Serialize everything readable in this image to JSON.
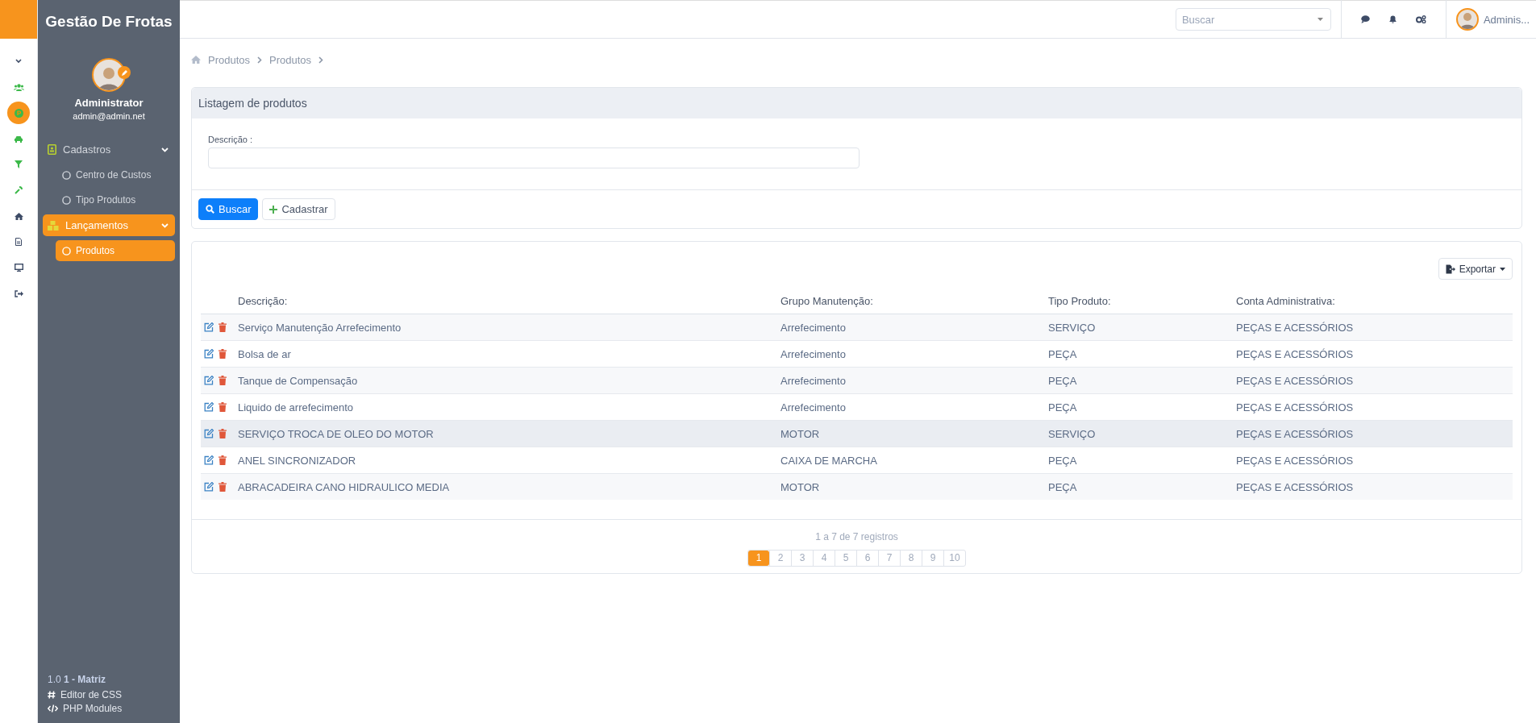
{
  "icon_bar": [
    {
      "kind": "chevron",
      "selected": false
    },
    {
      "kind": "users",
      "selected": false
    },
    {
      "kind": "parking",
      "selected": true
    },
    {
      "kind": "car",
      "selected": false
    },
    {
      "kind": "filter",
      "selected": false
    },
    {
      "kind": "wrench",
      "selected": false
    },
    {
      "kind": "home",
      "selected": false
    },
    {
      "kind": "file",
      "selected": false
    },
    {
      "kind": "monitor",
      "selected": false
    },
    {
      "kind": "signout",
      "selected": false
    }
  ],
  "sidebar": {
    "title": "Gestão De Frotas",
    "user": {
      "name": "Administrator",
      "email": "admin@admin.net"
    },
    "menu": [
      {
        "kind": "contact",
        "label": "Cadastros",
        "expanded": true,
        "selected": false,
        "children": [
          {
            "label": "Centro de Custos",
            "selected": false
          },
          {
            "label": "Tipo Produtos",
            "selected": false
          }
        ]
      },
      {
        "kind": "boxes",
        "label": "Lançamentos",
        "expanded": true,
        "selected": true,
        "children": [
          {
            "label": "Produtos",
            "selected": true
          }
        ]
      }
    ],
    "footer": {
      "version": "1.0 **1 - Matriz**",
      "links": [
        {
          "kind": "hash",
          "label": "Editor de CSS"
        },
        {
          "kind": "code",
          "label": "PHP Modules"
        }
      ]
    }
  },
  "topbar": {
    "search": {
      "placeholder": "Buscar"
    },
    "user": "Adminis..."
  },
  "breadcrumb": [
    "Produtos",
    "Produtos"
  ],
  "filter_panel": {
    "title": "Listagem de produtos",
    "field": {
      "label": "Descrição :"
    },
    "buttons": [
      {
        "kind": "primary",
        "label": "Buscar"
      },
      {
        "kind": "default",
        "label": "Cadastrar"
      }
    ]
  },
  "table": {
    "export": "Exportar",
    "columns": [
      "Descrição:",
      "Grupo Manutenção:",
      "Tipo Produto:",
      "Conta Administrativa:"
    ],
    "rows": [
      {
        "selected": false,
        "cells": [
          "Serviço Manutenção Arrefecimento",
          "Arrefecimento",
          "SERVIÇO",
          "PEÇAS E ACESSÓRIOS"
        ]
      },
      {
        "selected": false,
        "cells": [
          "Bolsa de ar",
          "Arrefecimento",
          "PEÇA",
          "PEÇAS E ACESSÓRIOS"
        ]
      },
      {
        "selected": false,
        "cells": [
          "Tanque de Compensação",
          "Arrefecimento",
          "PEÇA",
          "PEÇAS E ACESSÓRIOS"
        ]
      },
      {
        "selected": false,
        "cells": [
          "Liquido de arrefecimento",
          "Arrefecimento",
          "PEÇA",
          "PEÇAS E ACESSÓRIOS"
        ]
      },
      {
        "selected": true,
        "cells": [
          "SERVIÇO TROCA DE OLEO DO MOTOR",
          "MOTOR",
          "SERVIÇO",
          "PEÇAS E ACESSÓRIOS"
        ]
      },
      {
        "selected": false,
        "cells": [
          "ANEL SINCRONIZADOR",
          "CAIXA DE MARCHA",
          "PEÇA",
          "PEÇAS E ACESSÓRIOS"
        ]
      },
      {
        "selected": false,
        "cells": [
          "ABRACADEIRA CANO HIDRAULICO MEDIA",
          "MOTOR",
          "PEÇA",
          "PEÇAS E ACESSÓRIOS"
        ]
      }
    ],
    "summary": "1 a 7 de 7 registros",
    "pages": [
      {
        "label": "1",
        "selected": true
      },
      {
        "label": "2",
        "selected": false
      },
      {
        "label": "3",
        "selected": false
      },
      {
        "label": "4",
        "selected": false
      },
      {
        "label": "5",
        "selected": false
      },
      {
        "label": "6",
        "selected": false
      },
      {
        "label": "7",
        "selected": false
      },
      {
        "label": "8",
        "selected": false
      },
      {
        "label": "9",
        "selected": false
      },
      {
        "label": "10",
        "selected": false
      }
    ]
  }
}
